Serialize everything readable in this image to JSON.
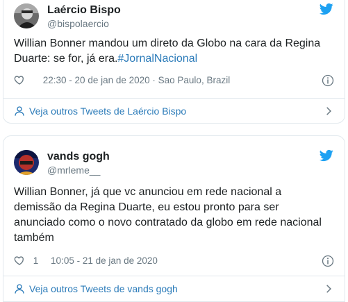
{
  "tweets": [
    {
      "name": "Laércio Bispo",
      "handle": "@bispolaercio",
      "text": "Willian Bonner mandou um direto da Globo na cara da Regina\nDuarte: se for, já era.",
      "hashtag": "#JornalNacional",
      "likes": "",
      "timestamp": "22:30 - 20 de jan de 2020 · Sao Paulo, Brazil",
      "more_link": "Veja outros Tweets de Laércio Bispo",
      "icons": [
        "heart-icon",
        "info-icon",
        "twitter-bird-icon",
        "user-icon",
        "chevron-right-icon"
      ]
    },
    {
      "name": "vands gogh",
      "handle": "@mrleme__",
      "text": "Willian Bonner, já que vc anunciou em rede nacional a\ndemissão da Regina Duarte, eu estou pronto para ser\nanunciado como o novo contratado da globo em rede nacional\ntambém",
      "hashtag": "",
      "likes": "1",
      "timestamp": "10:05 - 21 de jan de 2020",
      "more_link": "Veja outros Tweets de vands gogh",
      "icons": [
        "heart-icon",
        "info-icon",
        "twitter-bird-icon",
        "user-icon",
        "chevron-right-icon"
      ]
    }
  ],
  "colors": {
    "text": "#1c2022",
    "secondary": "#697882",
    "link": "#2b7bb9",
    "twitter_blue": "#1da1f2",
    "border": "#e1e8ed"
  }
}
